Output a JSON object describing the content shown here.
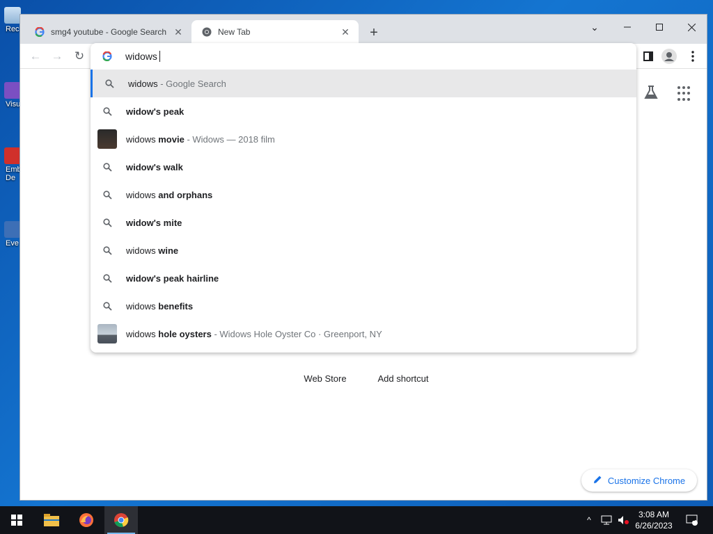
{
  "desktop": {
    "icons": [
      {
        "label": "Rec",
        "icon": "recycle-bin-icon"
      },
      {
        "label": "Visu",
        "icon": "visual-studio-icon"
      },
      {
        "label": "Emb",
        "icon": "app-icon"
      },
      {
        "label": "De",
        "icon": "app-icon"
      },
      {
        "label": "Eve",
        "icon": "event-viewer-icon"
      }
    ]
  },
  "browser": {
    "tabs": [
      {
        "title": "smg4 youtube - Google Search",
        "favicon": "google-icon",
        "active": false
      },
      {
        "title": "New Tab",
        "favicon": "chrome-icon",
        "active": true
      }
    ],
    "omnibox": {
      "text": "widows",
      "suggestions": [
        {
          "icon": "search-icon",
          "parts": [
            {
              "text": "widows",
              "bold": false
            }
          ],
          "desc": " - Google Search",
          "selected": true
        },
        {
          "icon": "search-icon",
          "parts": [
            {
              "text": "widow's peak",
              "bold": true
            }
          ],
          "desc": ""
        },
        {
          "icon": "movie-thumbnail",
          "parts": [
            {
              "text": "widows ",
              "bold": false
            },
            {
              "text": "movie",
              "bold": true
            }
          ],
          "desc": " - Widows — 2018 film"
        },
        {
          "icon": "search-icon",
          "parts": [
            {
              "text": "widow's walk",
              "bold": true
            }
          ],
          "desc": ""
        },
        {
          "icon": "search-icon",
          "parts": [
            {
              "text": "widows ",
              "bold": false
            },
            {
              "text": "and orphans",
              "bold": true
            }
          ],
          "desc": ""
        },
        {
          "icon": "search-icon",
          "parts": [
            {
              "text": "widow's mite",
              "bold": true
            }
          ],
          "desc": ""
        },
        {
          "icon": "search-icon",
          "parts": [
            {
              "text": "widows ",
              "bold": false
            },
            {
              "text": "wine",
              "bold": true
            }
          ],
          "desc": ""
        },
        {
          "icon": "search-icon",
          "parts": [
            {
              "text": "widow's peak hairline",
              "bold": true
            }
          ],
          "desc": ""
        },
        {
          "icon": "search-icon",
          "parts": [
            {
              "text": "widows ",
              "bold": false
            },
            {
              "text": "benefits",
              "bold": true
            }
          ],
          "desc": ""
        },
        {
          "icon": "place-thumbnail",
          "parts": [
            {
              "text": "widows ",
              "bold": false
            },
            {
              "text": "hole oysters",
              "bold": true
            }
          ],
          "desc": " - Widows Hole Oyster Co · Greenport, NY"
        }
      ]
    },
    "newtab": {
      "shortcuts": [
        "Web Store",
        "Add shortcut"
      ],
      "customize_label": "Customize Chrome"
    }
  },
  "taskbar": {
    "time": "3:08 AM",
    "date": "6/26/2023",
    "notification_count": "1"
  },
  "colors": {
    "accent": "#1a73e8",
    "taskbar": "#111318",
    "desktop": "#1475d1"
  }
}
